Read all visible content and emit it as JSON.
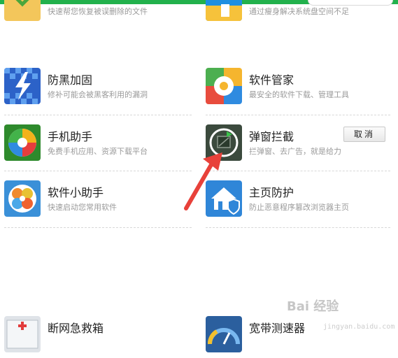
{
  "tools": [
    {
      "id": "restore",
      "title": "",
      "desc": "快速帮您恢复被误删除的文件",
      "icon": "file-restore-icon"
    },
    {
      "id": "disk-slim",
      "title": "",
      "desc": "通过瘦身解决系统盘空间不足",
      "icon": "disk-slim-icon"
    },
    {
      "id": "anti-hack",
      "title": "防黑加固",
      "desc": "修补可能会被黑客利用的漏洞",
      "icon": "lightning-shield-icon"
    },
    {
      "id": "software-manager",
      "title": "软件管家",
      "desc": "最安全的软件下载、管理工具",
      "icon": "software-manager-icon"
    },
    {
      "id": "phone-assistant",
      "title": "手机助手",
      "desc": "免费手机应用、资源下载平台",
      "icon": "phone-assistant-icon"
    },
    {
      "id": "popup-blocker",
      "title": "弹窗拦截",
      "desc": "拦弹窗、去广告，就是给力",
      "icon": "popup-blocker-icon"
    },
    {
      "id": "mini-assistant",
      "title": "软件小助手",
      "desc": "快速启动您常用软件",
      "icon": "mini-assistant-icon"
    },
    {
      "id": "homepage-protect",
      "title": "主页防护",
      "desc": "防止恶意程序篡改浏览器主页",
      "icon": "home-shield-icon"
    },
    {
      "id": "net-firstaid",
      "title": "断网急救箱",
      "desc": "",
      "icon": "first-aid-kit-icon"
    },
    {
      "id": "speed-test",
      "title": "宽带测速器",
      "desc": "",
      "icon": "speedometer-icon"
    }
  ],
  "cancel_label": "取消",
  "watermark": {
    "text": "Bai 经验",
    "sub": "jingyan.baidu.com"
  },
  "colors": {
    "accent": "#22b14c",
    "arrow": "#e8413a"
  }
}
